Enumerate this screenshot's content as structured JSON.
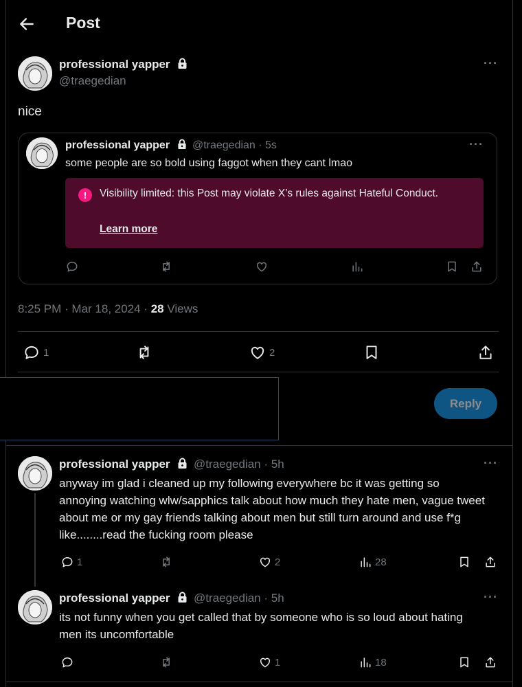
{
  "header": {
    "title": "Post"
  },
  "main_post": {
    "display_name": "professional yapper",
    "handle": "@traegedian",
    "text": "nice",
    "timestamp": "8:25 PM · Mar 18, 2024 · ",
    "views_count": "28",
    "views_label": " Views",
    "stats": {
      "replies": "1",
      "likes": "2"
    }
  },
  "quote": {
    "display_name": "professional yapper",
    "handle_time": "@traegedian · 5s",
    "text": "some people are so bold using faggot when they cant lmao",
    "notice_text": "Visibility limited: this Post may violate X’s rules against Hateful Conduct.",
    "notice_link": "Learn more",
    "colors": {
      "notice_bg": "#4e0b2c",
      "notice_icon": "#f91880"
    }
  },
  "reply_box": {
    "button_label": "Reply",
    "button_color": "#1d9bf0"
  },
  "replies": [
    {
      "display_name": "professional yapper",
      "handle_time": "@traegedian · 5h",
      "text": "anyway im glad i cleaned up my following everywhere bc it was getting so annoying watching wlw/sapphics talk about how much they hate men, vague tweet about me or my gay friends talking about men but still turn around and use f*g like........read the fucking room please",
      "replies": "1",
      "likes": "2",
      "views": "28"
    },
    {
      "display_name": "professional yapper",
      "handle_time": "@traegedian · 5h",
      "text": "its not funny when you get called that by someone who is so loud about hating men its uncomfortable",
      "replies": "",
      "likes": "1",
      "views": "18"
    }
  ],
  "icons": [
    "back-arrow-icon",
    "lock-icon",
    "more-icon",
    "reply-icon",
    "repost-icon",
    "like-icon",
    "views-icon",
    "bookmark-icon",
    "share-icon",
    "info-icon"
  ]
}
